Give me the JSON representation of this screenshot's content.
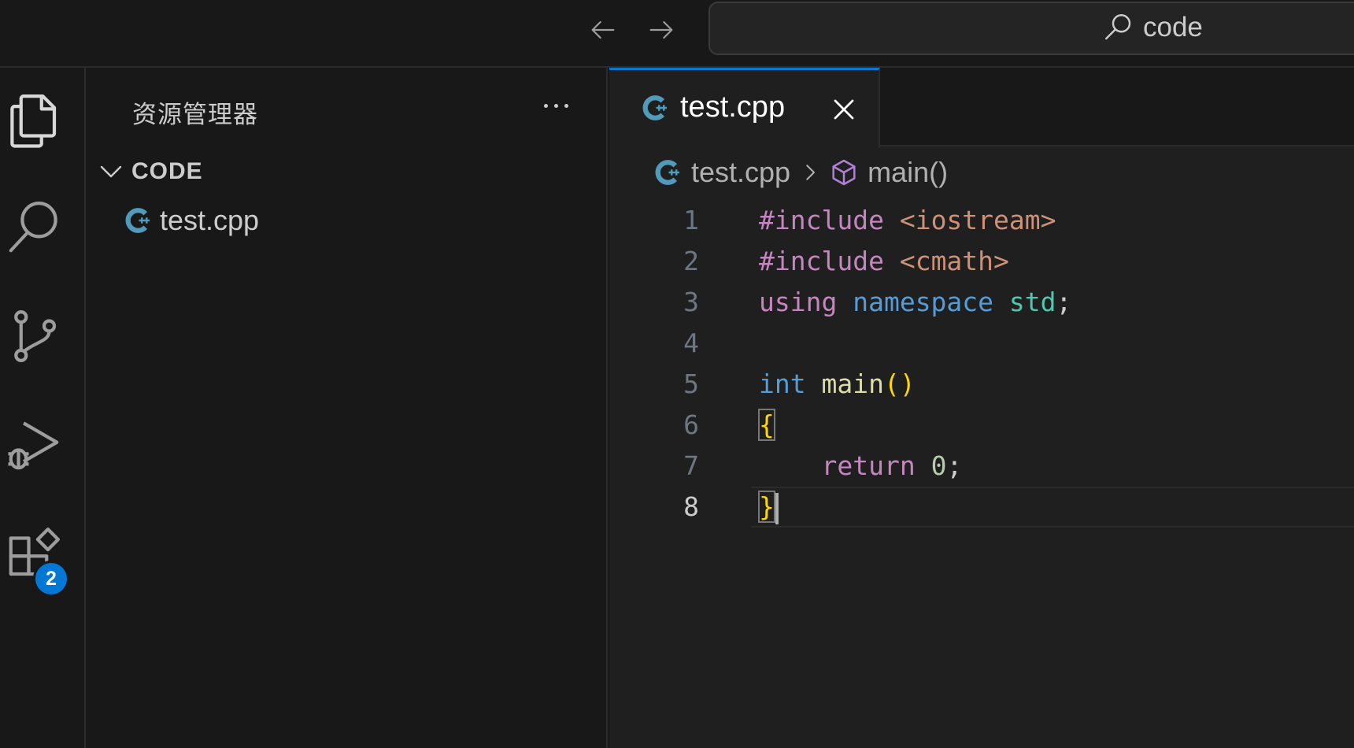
{
  "titlebar": {
    "search_text": "code"
  },
  "activity_bar": {
    "items": [
      "explorer-icon",
      "search-icon",
      "source-control-icon",
      "run-debug-icon",
      "extensions-icon"
    ],
    "extensions_badge": "2"
  },
  "sidebar": {
    "title": "资源管理器",
    "folder": "CODE",
    "files": [
      {
        "name": "test.cpp",
        "icon": "cpp-file-icon"
      }
    ]
  },
  "editor": {
    "tab": {
      "label": "test.cpp"
    },
    "breadcrumb": {
      "file": "test.cpp",
      "symbol": "main()"
    },
    "line_numbers": [
      "1",
      "2",
      "3",
      "4",
      "5",
      "6",
      "7",
      "8"
    ],
    "code": {
      "l1_directive": "#include",
      "l1_header": "<iostream>",
      "l2_directive": "#include",
      "l2_header": "<cmath>",
      "l3_using": "using",
      "l3_namespace": "namespace",
      "l3_std": "std",
      "l3_semi": ";",
      "l5_type": "int",
      "l5_fn": "main",
      "l5_parens": "()",
      "l6_open": "{",
      "l7_return": "return",
      "l7_value": "0",
      "l7_semi": ";",
      "l8_close": "}"
    }
  },
  "colors": {
    "accent": "#0078d4",
    "keyword": "#c586c0",
    "string": "#ce9178",
    "storage": "#569cd6",
    "type": "#4ec9b0",
    "function": "#dcdcaa",
    "bracket": "#ffd700",
    "number": "#b5cea8",
    "cpp_icon": "#519aba"
  }
}
